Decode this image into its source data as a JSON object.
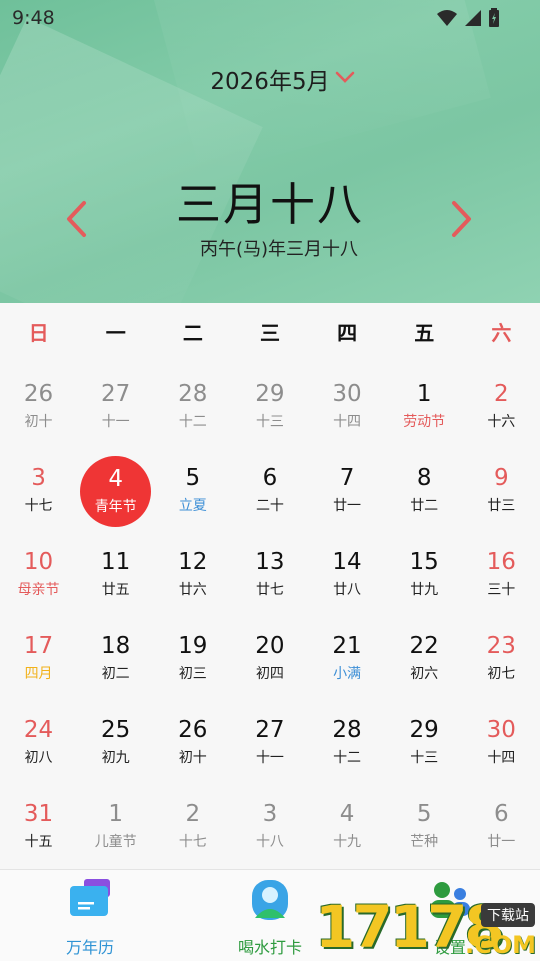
{
  "status": {
    "time": "9:48"
  },
  "header": {
    "month_label": "2026年5月",
    "lunar_date": "三月十八",
    "lunar_full": "丙午(马)年三月十八"
  },
  "weekdays": [
    "日",
    "一",
    "二",
    "三",
    "四",
    "五",
    "六"
  ],
  "weeks": [
    [
      {
        "d": "26",
        "l": "初十",
        "other": true
      },
      {
        "d": "27",
        "l": "十一",
        "other": true
      },
      {
        "d": "28",
        "l": "十二",
        "other": true
      },
      {
        "d": "29",
        "l": "十三",
        "other": true
      },
      {
        "d": "30",
        "l": "十四",
        "other": true
      },
      {
        "d": "1",
        "l": "劳动节",
        "type": "holiday"
      },
      {
        "d": "2",
        "l": "十六"
      }
    ],
    [
      {
        "d": "3",
        "l": "十七"
      },
      {
        "d": "4",
        "l": "青年节",
        "today": true
      },
      {
        "d": "5",
        "l": "立夏",
        "type": "term"
      },
      {
        "d": "6",
        "l": "二十"
      },
      {
        "d": "7",
        "l": "廿一"
      },
      {
        "d": "8",
        "l": "廿二"
      },
      {
        "d": "9",
        "l": "廿三"
      }
    ],
    [
      {
        "d": "10",
        "l": "母亲节",
        "type": "holiday"
      },
      {
        "d": "11",
        "l": "廿五"
      },
      {
        "d": "12",
        "l": "廿六"
      },
      {
        "d": "13",
        "l": "廿七"
      },
      {
        "d": "14",
        "l": "廿八"
      },
      {
        "d": "15",
        "l": "廿九"
      },
      {
        "d": "16",
        "l": "三十"
      }
    ],
    [
      {
        "d": "17",
        "l": "四月",
        "type": "month"
      },
      {
        "d": "18",
        "l": "初二"
      },
      {
        "d": "19",
        "l": "初三"
      },
      {
        "d": "20",
        "l": "初四"
      },
      {
        "d": "21",
        "l": "小满",
        "type": "term"
      },
      {
        "d": "22",
        "l": "初六"
      },
      {
        "d": "23",
        "l": "初七"
      }
    ],
    [
      {
        "d": "24",
        "l": "初八"
      },
      {
        "d": "25",
        "l": "初九"
      },
      {
        "d": "26",
        "l": "初十"
      },
      {
        "d": "27",
        "l": "十一"
      },
      {
        "d": "28",
        "l": "十二"
      },
      {
        "d": "29",
        "l": "十三"
      },
      {
        "d": "30",
        "l": "十四"
      }
    ],
    [
      {
        "d": "31",
        "l": "十五"
      },
      {
        "d": "1",
        "l": "儿童节",
        "other": true
      },
      {
        "d": "2",
        "l": "十七",
        "other": true
      },
      {
        "d": "3",
        "l": "十八",
        "other": true
      },
      {
        "d": "4",
        "l": "十九",
        "other": true
      },
      {
        "d": "5",
        "l": "芒种",
        "other": true
      },
      {
        "d": "6",
        "l": "廿一",
        "other": true
      }
    ]
  ],
  "tabs": [
    {
      "label": "万年历",
      "icon": "calendar-folder-icon"
    },
    {
      "label": "喝水打卡",
      "icon": "user-profile-icon"
    },
    {
      "label": "设置",
      "icon": "people-settings-icon"
    }
  ],
  "watermark": {
    "text": "17178",
    "badge": "下载站",
    "domain": ".COM"
  },
  "colors": {
    "accent_red": "#ef3535",
    "weekend": "#e45b5b",
    "term_blue": "#3d8fd6",
    "month_gold": "#f2b21a",
    "header_green": "#7cc6a3"
  }
}
